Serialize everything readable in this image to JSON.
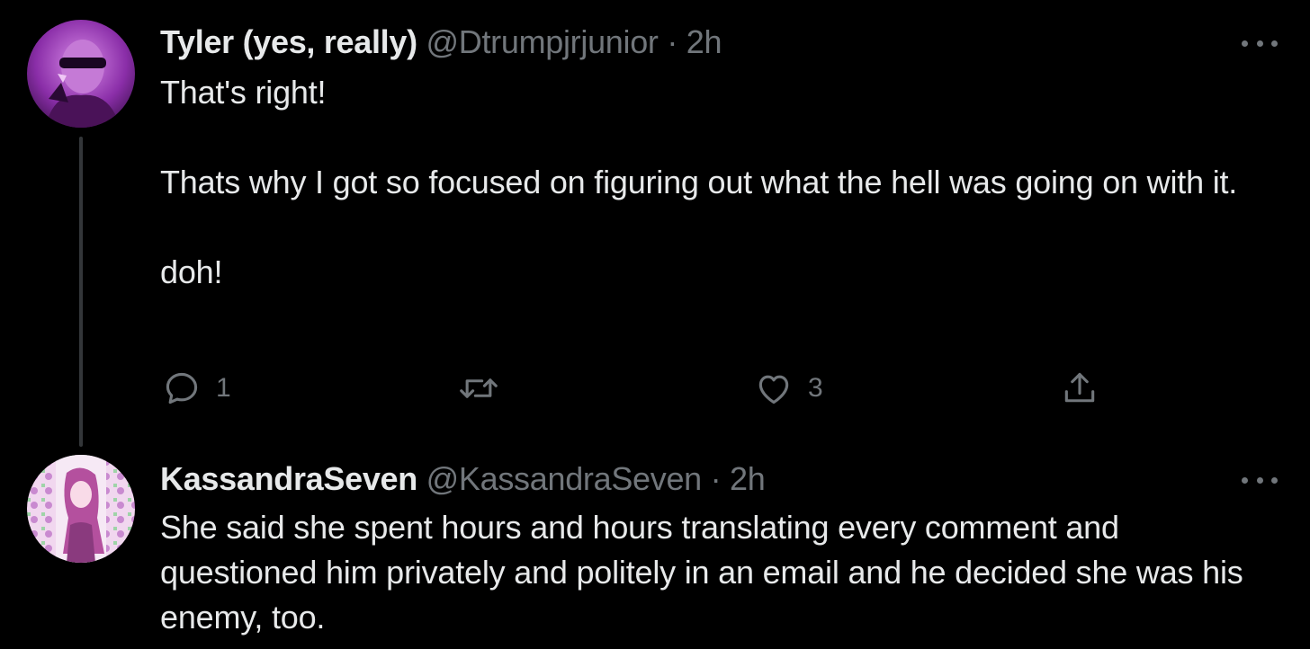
{
  "tweets": [
    {
      "display_name": "Tyler (yes, really)",
      "handle": "@Dtrumpjrjunior",
      "separator": "·",
      "time": "2h",
      "text": "That's right!\n\nThats why I got so focused on figuring out what the hell was going on with it.\n\ndoh!",
      "reply_count": "1",
      "retweet_count": "",
      "like_count": "3",
      "avatar_icon": "user-avatar-magenta-sunglasses"
    },
    {
      "display_name": "KassandraSeven",
      "handle": "@KassandraSeven",
      "separator": "·",
      "time": "2h",
      "text": "She said she spent hours and hours translating every comment and questioned him privately and politely in an email and he decided she was his enemy, too.",
      "avatar_icon": "user-avatar-pink-illustration"
    }
  ],
  "icons": {
    "reply": "speech-bubble-icon",
    "retweet": "retweet-arrows-icon",
    "like": "heart-icon",
    "share": "share-upload-icon",
    "more": "more-dots-icon"
  },
  "colors": {
    "background": "#000000",
    "text_primary": "#e7e9ea",
    "text_secondary": "#71767b",
    "thread_line": "#333639",
    "avatar_1_tint": "#b24fd6",
    "avatar_2_tint": "#e8a8e4"
  }
}
